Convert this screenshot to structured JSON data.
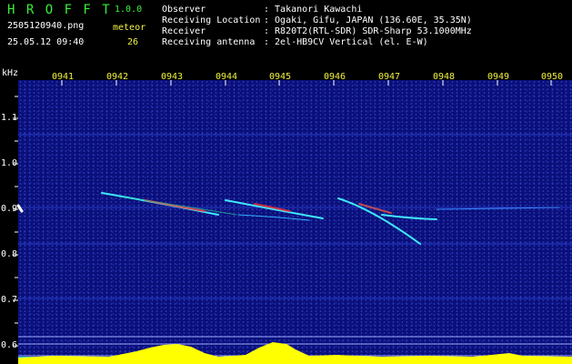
{
  "header": {
    "app_title": "H R O F F T",
    "version": "1.0.0",
    "filename": "2505120940.png",
    "datetime": "25.05.12 09:40",
    "meteor_label": "meteor",
    "meteor_count": "26",
    "info": [
      {
        "key": "Observer",
        "value": ": Takanori Kawachi"
      },
      {
        "key": "Receiving Location",
        "value": ": Ogaki, Gifu, JAPAN (136.60E, 35.35N)"
      },
      {
        "key": "Receiver",
        "value": ": R820T2(RTL-SDR) SDR-Sharp 53.1000MHz"
      },
      {
        "key": "Receiving antenna",
        "value": ": 2el-HB9CV Vertical (el. E-W)"
      }
    ]
  },
  "axis": {
    "unit": "kHz",
    "time_ticks": [
      "0941",
      "0942",
      "0943",
      "0944",
      "0945",
      "0946",
      "0947",
      "0948",
      "0949",
      "0950"
    ],
    "freq_ticks": [
      "1.1",
      "1.0",
      "0.9",
      "0.8",
      "0.7",
      "0.6"
    ]
  },
  "colors": {
    "header_green": "#39f039",
    "header_white": "#ffffff",
    "tick_yellow": "#f0f040",
    "background_blue": "#0a0f7a",
    "trail_cyan": "#40e8ff",
    "trail_red": "#ff3030",
    "level_yellow": "#ffff00"
  }
}
